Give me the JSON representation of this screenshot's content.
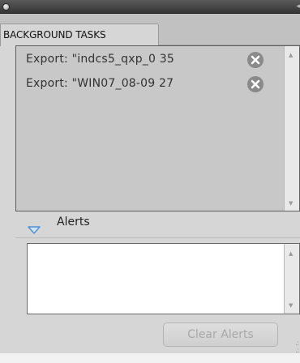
{
  "panel": {
    "tab_label": "BACKGROUND TASKS"
  },
  "tasks": [
    {
      "label": "Export: \"indcs5_qxp_0 35",
      "cancel_icon": "cancel-circle-icon"
    },
    {
      "label": "Export: \"WIN07_08-09 27",
      "cancel_icon": "cancel-circle-icon"
    }
  ],
  "alerts": {
    "label": "Alerts",
    "disclosure_icon": "disclosure-triangle-down-icon",
    "items": [],
    "clear_button_label": "Clear Alerts",
    "clear_button_enabled": false
  },
  "colors": {
    "titlebar": "#424242",
    "panel_bg": "#d6d6d6",
    "list_bg": "#c8c8c8",
    "accent_triangle": "#4f8fd6",
    "disabled_text": "#a8a8a8"
  }
}
